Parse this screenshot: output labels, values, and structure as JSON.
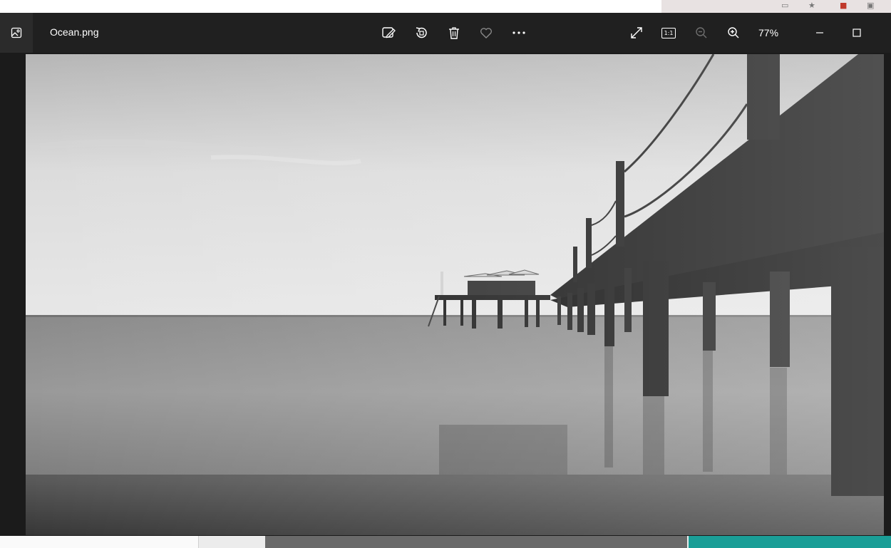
{
  "window": {
    "file_name": "Ocean.png",
    "zoom_level": "77%"
  },
  "toolbar": {
    "edit_icon": "edit-image-icon",
    "rotate_icon": "rotate-icon",
    "delete_icon": "trash-icon",
    "favorite_icon": "heart-icon",
    "more_icon": "more-icon",
    "fullscreen_icon": "expand-icon",
    "actual_size_label": "1:1",
    "zoom_out_icon": "zoom-out-icon",
    "zoom_in_icon": "zoom-in-icon"
  },
  "image": {
    "description_name": "ocean-pier-photo",
    "colors": {
      "sky_top": "#b9b9b9",
      "sky_bottom": "#e8e8e8",
      "sea": "#8c8c8c",
      "pier": "#151515"
    }
  }
}
